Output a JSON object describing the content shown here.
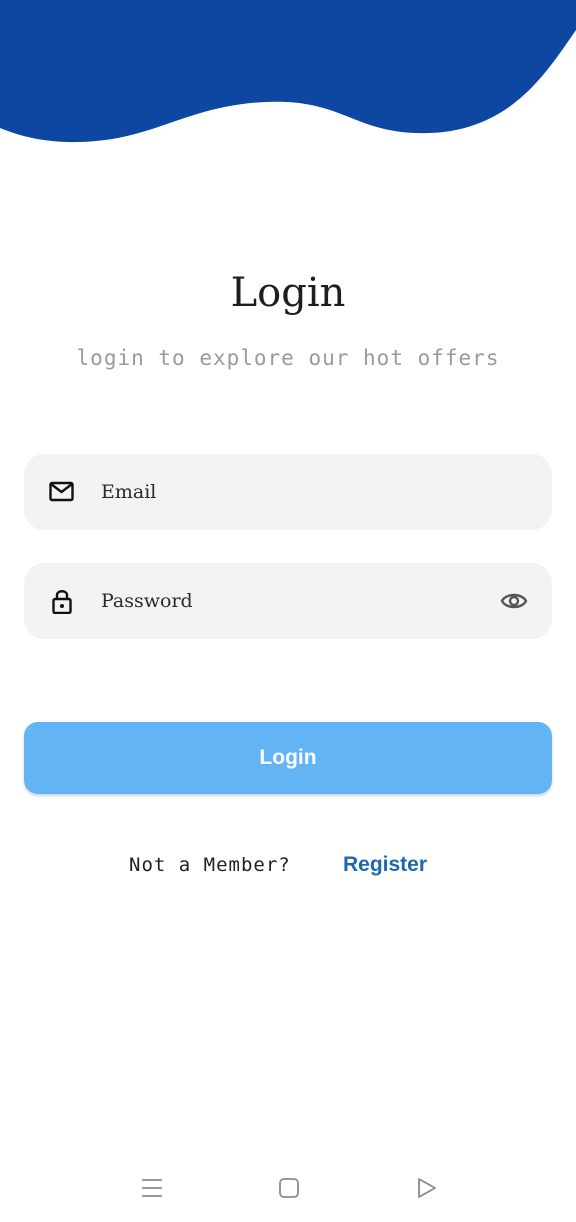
{
  "colors": {
    "wave": "#0d47a1",
    "field_background": "#f3f3f3",
    "login_button": "#63b4f4",
    "register_link": "#1c69b0"
  },
  "header": {
    "title": "Login",
    "subtitle": "login to explore our hot offers"
  },
  "form": {
    "email": {
      "icon": "mail-icon",
      "placeholder": "Email",
      "value": ""
    },
    "password": {
      "icon": "lock-icon",
      "placeholder": "Password",
      "value": "",
      "toggle_icon": "eye-icon"
    },
    "login_label": "Login"
  },
  "footer": {
    "prompt": "Not a Member?",
    "register_label": "Register"
  },
  "navbar": {
    "items": [
      "menu-icon",
      "home-square-icon",
      "back-triangle-icon"
    ]
  }
}
